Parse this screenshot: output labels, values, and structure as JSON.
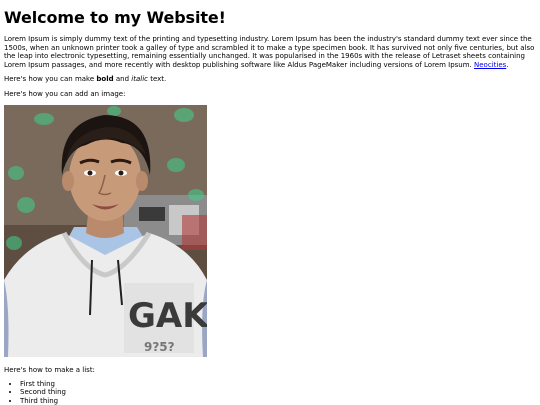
{
  "page": {
    "title": "Welcome to my Website!",
    "intro_text": "Lorem Ipsum is simply dummy text of the printing and typesetting industry. Lorem Ipsum has been the industry's standard dummy text ever since the 1500s, when an unknown printer took a galley of type and scrambled it to make a type specimen book. It has survived not only five centuries, but also the leap into electronic typesetting, remaining essentially unchanged. It was popularised in the 1960s with the release of Letraset sheets containing Lorem Ipsum passages, and more recently with desktop publishing software like Aldus PageMaker including versions of Lorem Ipsum.",
    "intro_link": "Neocities",
    "intro_tail": ".",
    "bold_line": {
      "prefix": "Here's how you can make ",
      "bold": "bold",
      "middle": " and ",
      "italic": "italic",
      "suffix": " text."
    },
    "image_line": "Here's how you can add an image:",
    "list_line": "Here's how to make a list:",
    "list_items": [
      "First thing",
      "Second thing",
      "Third thing"
    ]
  },
  "photo": {
    "shirt_text": "GAK",
    "shirt_subtext": "9?5?"
  }
}
